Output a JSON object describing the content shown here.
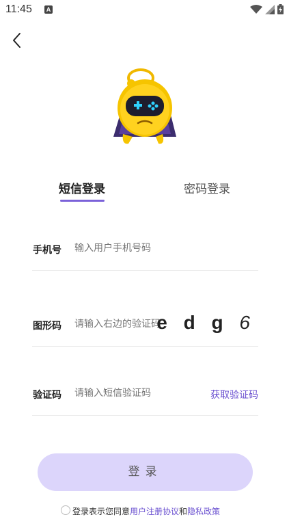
{
  "status": {
    "time": "11:45",
    "notif": "A"
  },
  "tabs": [
    {
      "label": "短信登录",
      "active": true
    },
    {
      "label": "密码登录",
      "active": false
    }
  ],
  "form": {
    "phone": {
      "label": "手机号",
      "placeholder": "输入用户手机号码"
    },
    "image_code": {
      "label": "图形码",
      "placeholder": "请输入右边的验证码",
      "captcha": "e d g ",
      "captcha_last": "6"
    },
    "sms_code": {
      "label": "验证码",
      "placeholder": "请输入短信验证码",
      "button": "获取验证码"
    }
  },
  "login_button": "登录",
  "agreement": {
    "prefix": "登录表示您同意",
    "terms": "用户注册协议",
    "and": "和",
    "privacy": "隐私政策"
  },
  "colors": {
    "accent": "#6a50d0",
    "button_bg": "#dcd5fb"
  },
  "icons": [
    "back-arrow-icon",
    "wifi-icon",
    "signal-icon",
    "battery-icon"
  ]
}
